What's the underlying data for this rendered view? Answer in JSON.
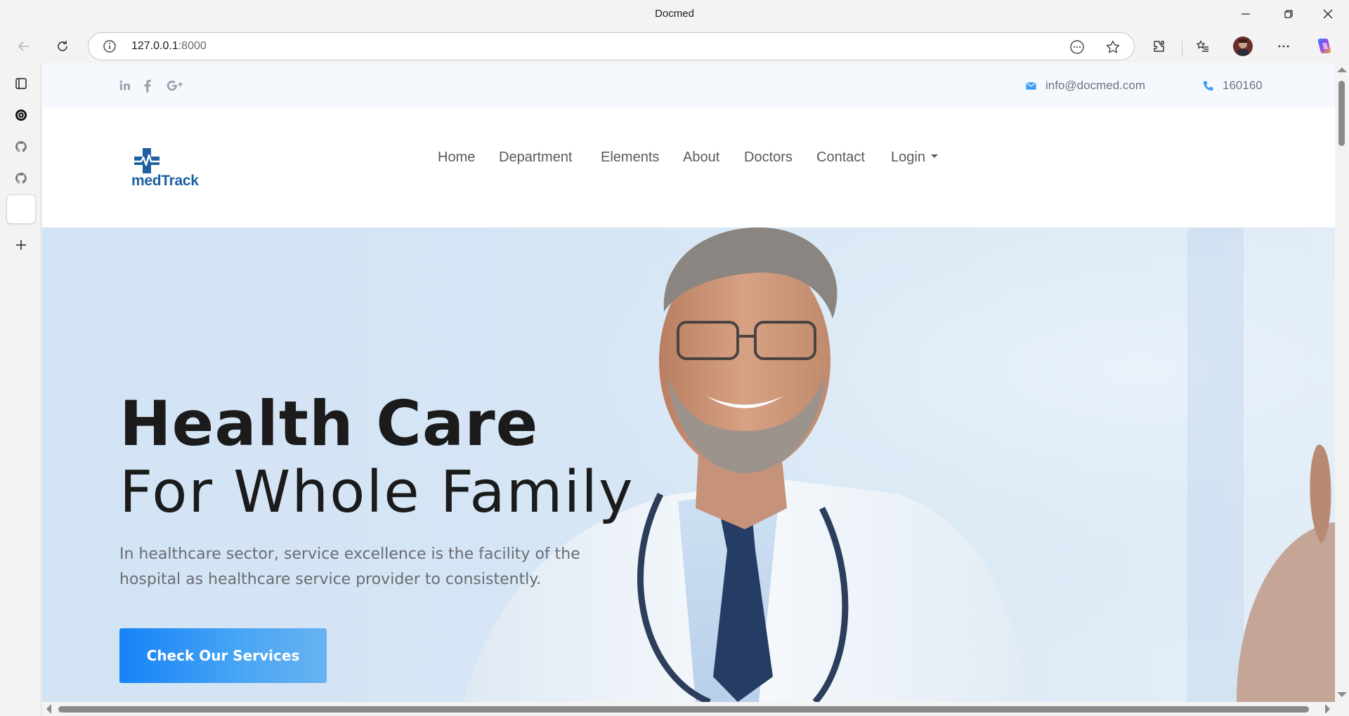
{
  "browser": {
    "window_title": "Docmed",
    "url_host": "127.0.0.1",
    "url_port": ":8000"
  },
  "topbar": {
    "social": [
      "linkedin-icon",
      "facebook-icon",
      "google-plus-icon"
    ],
    "email": "info@docmed.com",
    "phone": "160160"
  },
  "brand": {
    "logo_text": "medTrack",
    "accent": "#1e5fa0"
  },
  "nav": {
    "home": "Home",
    "department": "Department",
    "elements": "Elements",
    "about": "About",
    "doctors": "Doctors",
    "contact": "Contact",
    "login": "Login"
  },
  "hero": {
    "title_line1": "Health Care",
    "title_line2": "For Whole Family",
    "description": "In healthcare sector, service excellence is the facility of the hospital as healthcare service provider to consistently.",
    "cta_label": "Check Our Services",
    "cta_color": "#1683f8"
  }
}
